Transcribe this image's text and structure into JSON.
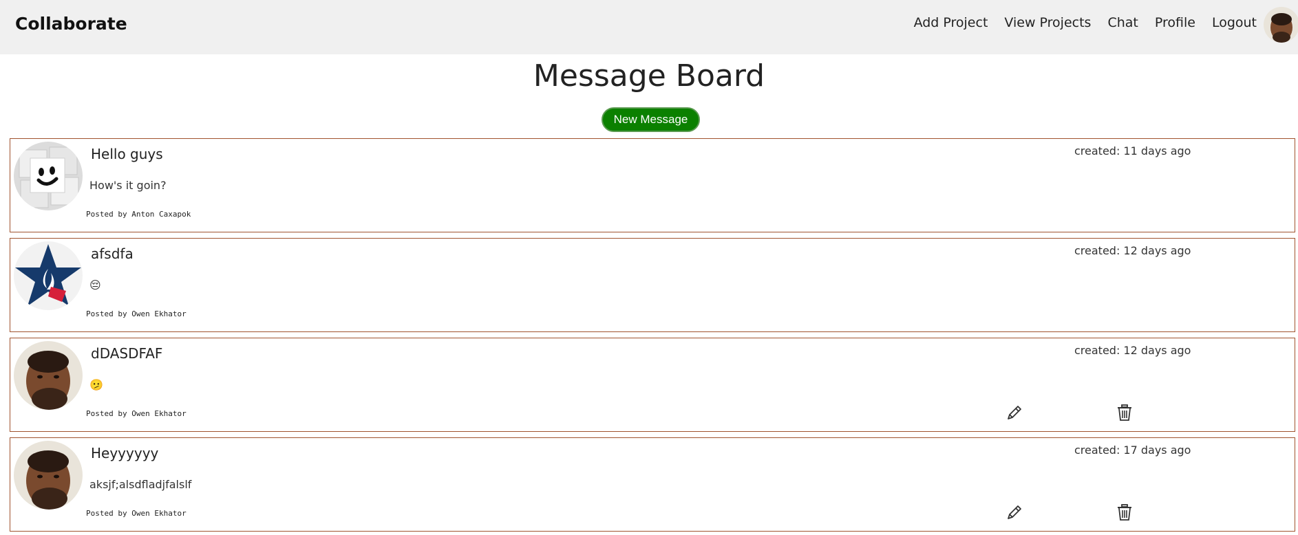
{
  "navbar": {
    "brand": "Collaborate",
    "links": [
      "Add Project",
      "View Projects",
      "Chat",
      "Profile",
      "Logout"
    ]
  },
  "page": {
    "title": "Message Board",
    "new_message_label": "New Message"
  },
  "messages": [
    {
      "title": "Hello guys",
      "body": "How's it goin?",
      "posted_by": "Posted by Anton Caxapok",
      "created": "created: 11 days ago",
      "avatar": "smiley-sugar-cube-avatar",
      "editable": false
    },
    {
      "title": "afsdfa",
      "body": "😔",
      "posted_by": "Posted by Owen Ekhator",
      "created": "created: 12 days ago",
      "avatar": "star-flame-logo-avatar",
      "editable": false
    },
    {
      "title": "dDASDFAF",
      "body": "🫤",
      "posted_by": "Posted by Owen Ekhator",
      "created": "created: 12 days ago",
      "avatar": "user-photo-avatar",
      "editable": true
    },
    {
      "title": "Heyyyyyy",
      "body": "aksjf;alsdfladjfalslf",
      "posted_by": "Posted by Owen Ekhator",
      "created": "created: 17 days ago",
      "avatar": "user-photo-avatar",
      "editable": true
    }
  ],
  "colors": {
    "navbar_bg": "#f0f0f0",
    "button_green": "#0b8000",
    "card_border": "#a0522d"
  },
  "icons": {
    "edit": "pencil-icon",
    "delete": "trash-icon"
  }
}
